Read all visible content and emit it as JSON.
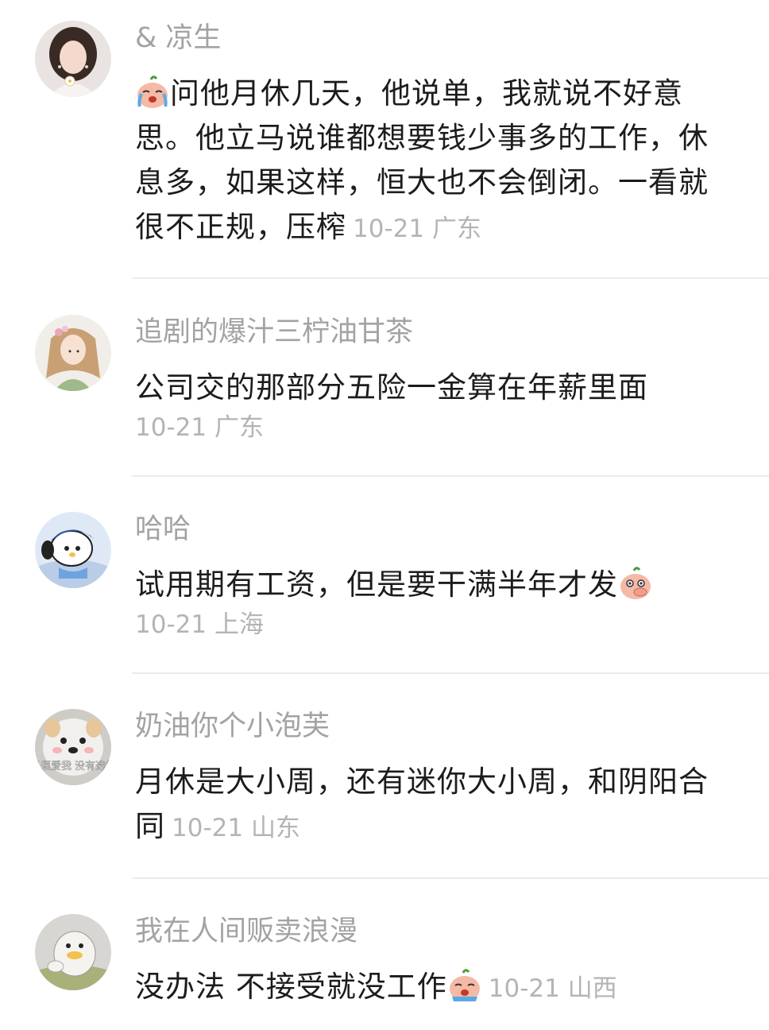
{
  "comments": [
    {
      "username": "& 凉生",
      "text_before": "",
      "text_after": "问他月休几天，他说单，我就说不好意思。他立马说谁都想要钱少事多的工作，休息多，如果这样，恒大也不会倒闭。一看就很不正规，压榨",
      "emoji": "crying-face",
      "date": "10-21",
      "location": "广东"
    },
    {
      "username": "追剧的爆汁三柠油甘茶",
      "text": "公司交的那部分五险一金算在年薪里面",
      "date": "10-21",
      "location": "广东"
    },
    {
      "username": "哈哈",
      "text": "试用期有工资，但是要干满半年才发",
      "emoji": "covering-mouth-face",
      "date": "10-21",
      "location": "上海"
    },
    {
      "username": "奶油你个小泡芙",
      "text": "月休是大小周，还有迷你大小周，和阴阳合同",
      "avatar_caption": "必须爱我 没有选择",
      "date": "10-21",
      "location": "山东"
    },
    {
      "username": "我在人间贩卖浪漫",
      "text": "没办法 不接受就没工作",
      "emoji": "crying-face",
      "date": "10-21",
      "location": "山西"
    }
  ],
  "colors": {
    "username": "#a3a3a3",
    "text": "#1c1c1c",
    "meta": "#b4b4b4",
    "divider": "#ececec"
  }
}
